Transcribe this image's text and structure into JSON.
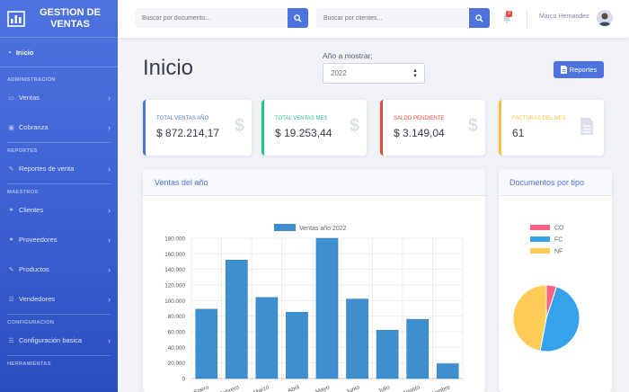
{
  "brand": {
    "title_line1": "GESTION DE",
    "title_line2": "VENTAS"
  },
  "sidebar": {
    "home": "Inicio",
    "sections": [
      {
        "heading": "ADMINISTRACIÓN",
        "items": [
          "Ventas",
          "Cobranza"
        ]
      },
      {
        "heading": "REPORTES",
        "items": [
          "Reportes de venta"
        ]
      },
      {
        "heading": "MAESTROS",
        "items": [
          "Clientes",
          "Proveedores",
          "Productos",
          "Vendedores"
        ]
      },
      {
        "heading": "CONFIGURACION",
        "items": [
          "Configuración basica"
        ]
      },
      {
        "heading": "HERRAMIENTAS",
        "items": []
      }
    ]
  },
  "topbar": {
    "search_docs_placeholder": "Buscar por documento...",
    "search_clients_placeholder": "Buscar por clientes...",
    "notif_count": "0",
    "user_name": "Marco Hernandez"
  },
  "page": {
    "title": "Inicio",
    "year_label": "Año a mostrar:",
    "year_value": "2022",
    "report_button": "Reportes"
  },
  "cards": [
    {
      "label": "TOTAL VENTAS AÑO",
      "value": "$ 872.214,17",
      "color": "#4e73df",
      "icon": "$"
    },
    {
      "label": "TOTAL VENTAS MES",
      "value": "$ 19.253,44",
      "color": "#1cc88a",
      "icon": "$"
    },
    {
      "label": "SALDO PENDIENTE",
      "value": "$ 3.149,04",
      "color": "#e74a3b",
      "icon": "$"
    },
    {
      "label": "FACTURAS DEL MES",
      "value": "61",
      "color": "#f6c23e",
      "icon": "document-icon"
    }
  ],
  "sales_panel": {
    "title": "Ventas del año"
  },
  "docs_panel": {
    "title": "Documentos por tipo"
  },
  "chart_data": [
    {
      "type": "bar",
      "title": "",
      "categories": [
        "Enero",
        "Febrero",
        "Marzo",
        "Abril",
        "Mayo",
        "Junio",
        "Julio",
        "Agosto",
        "Septiembre"
      ],
      "series": [
        {
          "name": "Ventas año 2022",
          "values": [
            89000,
            152000,
            104000,
            85000,
            180000,
            102000,
            62000,
            76000,
            19000
          ],
          "color": "#3d8fcf"
        }
      ],
      "ylim": [
        0,
        180000
      ],
      "yticks": [
        "180.000",
        "160.000",
        "140.000",
        "120.000",
        "100.000",
        "80.000",
        "60.000",
        "40.000",
        "20.000",
        "0"
      ],
      "legend": "top",
      "grid": true
    },
    {
      "type": "pie",
      "labels": [
        "CO",
        "FC",
        "NF"
      ],
      "values": [
        5,
        48,
        47
      ],
      "colors": [
        "#ff6384",
        "#36a2eb",
        "#ffcd56"
      ],
      "legend": "top"
    }
  ]
}
